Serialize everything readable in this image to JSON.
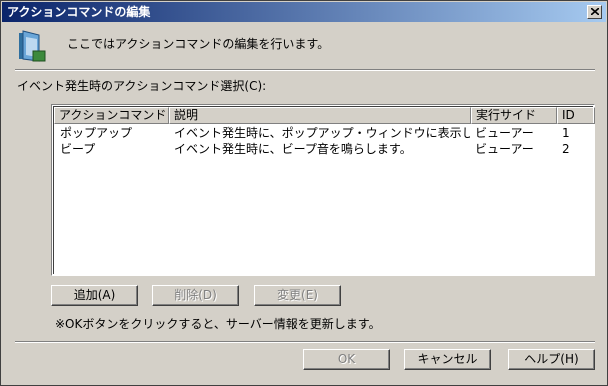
{
  "window": {
    "title": "アクションコマンドの編集"
  },
  "header": {
    "description": "ここではアクションコマンドの編集を行います。"
  },
  "section": {
    "label": "イベント発生時のアクションコマンド選択(C):"
  },
  "table": {
    "columns": [
      "アクションコマンド",
      "説明",
      "実行サイド",
      "ID"
    ],
    "rows": [
      [
        "ポップアップ",
        "イベント発生時に、ポップアップ・ウィンドウに表示します。",
        "ビューアー",
        "1"
      ],
      [
        "ビープ",
        "イベント発生時に、ビープ音を鳴らします。",
        "ビューアー",
        "2"
      ]
    ]
  },
  "actions": {
    "add": "追加(A)",
    "delete": "削除(D)",
    "change": "変更(E)"
  },
  "note": "※OKボタンをクリックすると、サーバー情報を更新します。",
  "footer": {
    "ok": "OK",
    "cancel": "キャンセル",
    "help": "ヘルプ(H)"
  },
  "icons": {
    "header": "monitor-icon",
    "close": "close-icon"
  },
  "colors": {
    "titlebar_start": "#0a246a",
    "titlebar_end": "#a6caf0",
    "face": "#d4d0c8"
  }
}
